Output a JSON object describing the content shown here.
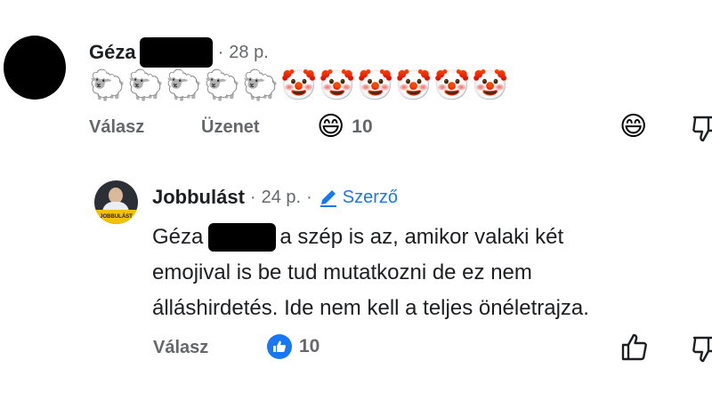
{
  "comment": {
    "author": "Géza",
    "time": "28 p.",
    "emojis": [
      "🐑",
      "🐑",
      "🐑",
      "🐑",
      "🐑",
      "🤡",
      "🤡",
      "🤡",
      "🤡",
      "🤡",
      "🤡"
    ],
    "reply_label": "Válasz",
    "message_label": "Üzenet",
    "reaction_emoji": "😄",
    "reaction_count": "10",
    "react_button_emoji": "😄"
  },
  "reply": {
    "author": "Jobbulást",
    "time": "24 p.",
    "author_badge": "Szerző",
    "avatar_label": "JOBBULÁST",
    "text_name": "Géza",
    "text_rest_1": "a szép is az, amikor valaki két",
    "text_line_2": "emojival is be tud mutatkozni de ez nem",
    "text_line_3": "álláshirdetés. Ide nem kell a teljes önéletrajza.",
    "reply_label": "Válasz",
    "like_count": "10"
  },
  "colors": {
    "accent": "#1877f2",
    "meta": "#65676b",
    "text": "#1c1e21"
  }
}
